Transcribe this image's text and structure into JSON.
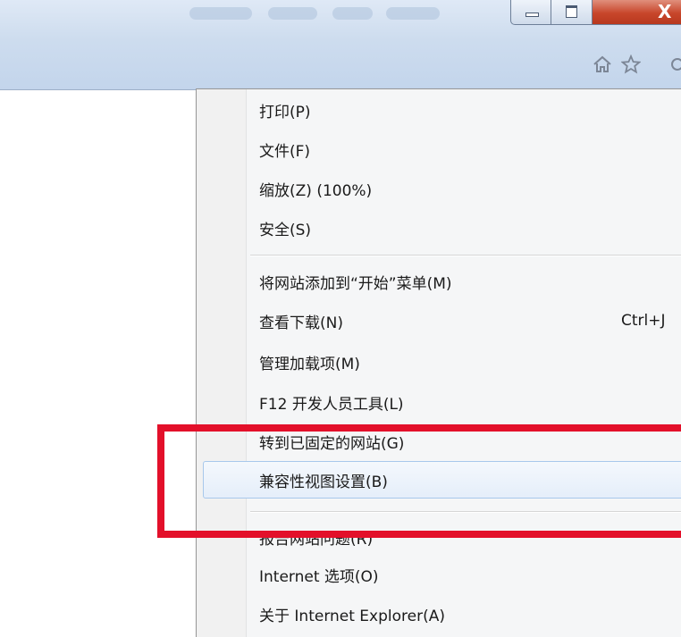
{
  "window": {
    "close_glyph": "X",
    "toolbar_icons": [
      "home-icon",
      "star-icon",
      "gear-icon"
    ]
  },
  "menu": {
    "items": [
      {
        "label": "打印(P)"
      },
      {
        "label": "文件(F)"
      },
      {
        "label": "缩放(Z) (100%)"
      },
      {
        "label": "安全(S)"
      },
      {
        "label": "将网站添加到“开始”菜单(M)"
      },
      {
        "label": "查看下载(N)",
        "shortcut": "Ctrl+J"
      },
      {
        "label": "管理加载项(M)"
      },
      {
        "label": "F12 开发人员工具(L)"
      },
      {
        "label": "转到已固定的网站(G)"
      },
      {
        "label": "兼容性视图设置(B)"
      },
      {
        "label": "报告网站问题(R)"
      },
      {
        "label": "Internet 选项(O)"
      },
      {
        "label": "关于 Internet Explorer(A)"
      }
    ],
    "highlighted_index": 9
  },
  "colors": {
    "annotation": "#e3102a",
    "highlight_border": "#a8c8eb"
  }
}
